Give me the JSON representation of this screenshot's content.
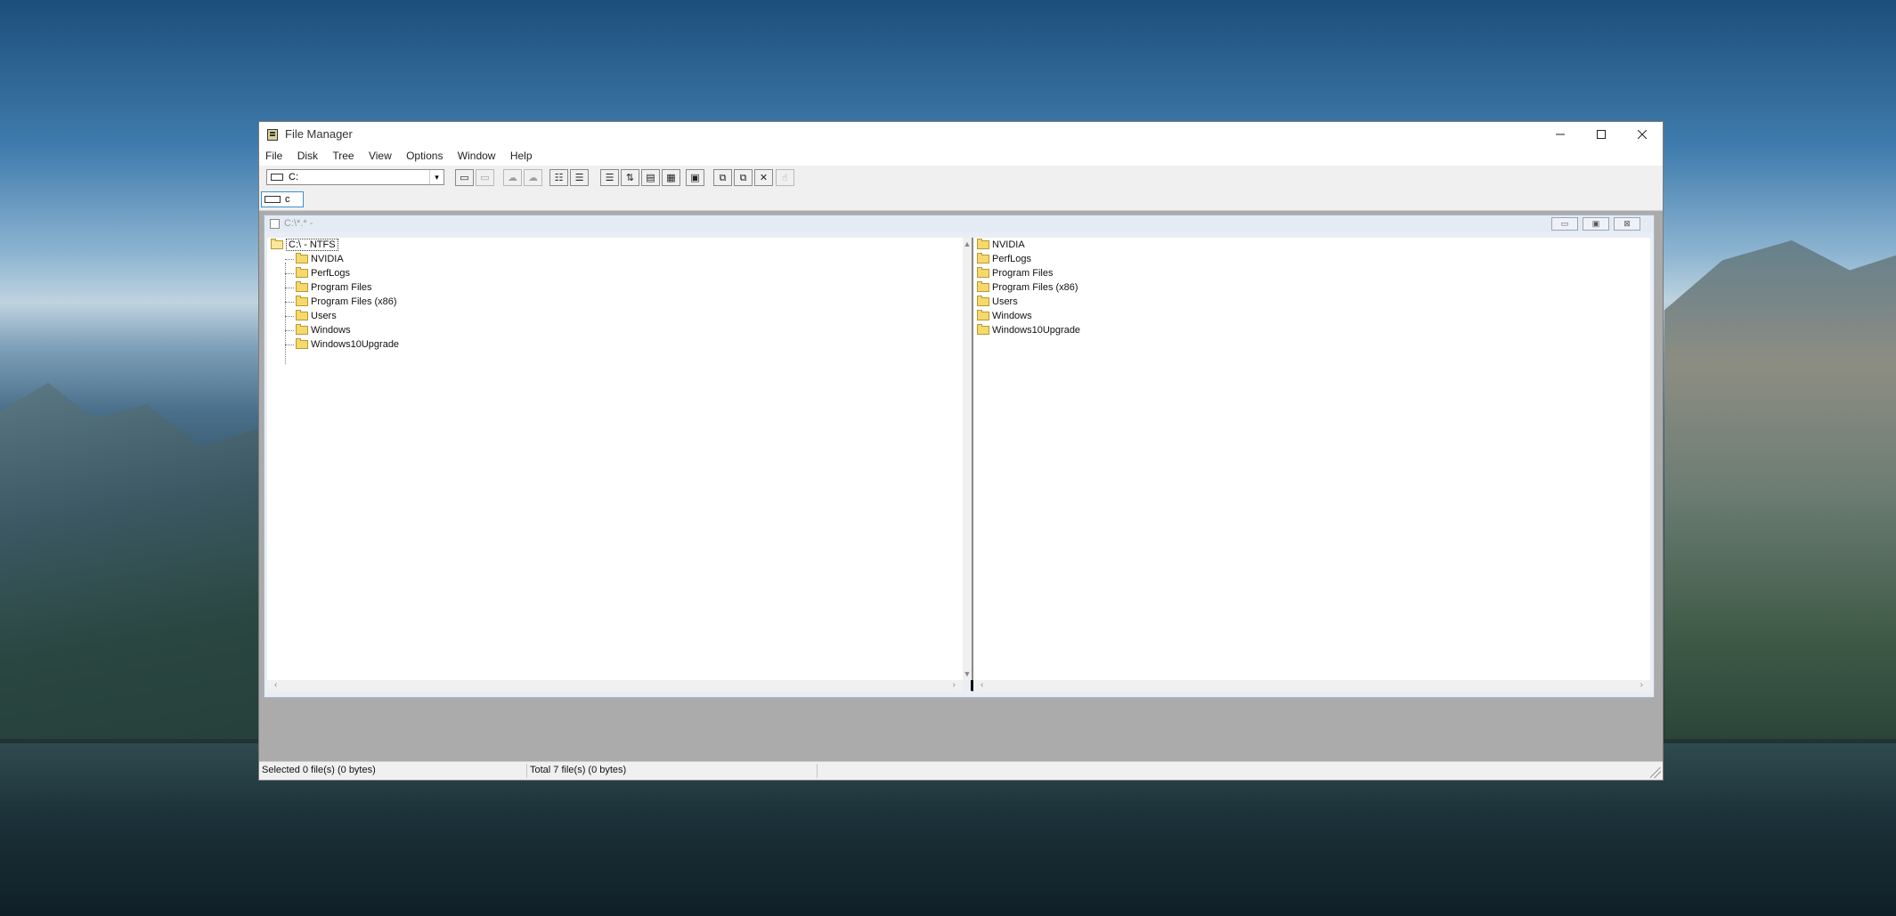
{
  "window": {
    "title": "File Manager"
  },
  "menu": [
    "File",
    "Disk",
    "Tree",
    "View",
    "Options",
    "Window",
    "Help"
  ],
  "toolbar": {
    "drive_selected": "C:",
    "combo_arrow": "▾"
  },
  "drivebar": {
    "drive_tab_label": "c"
  },
  "mdi": {
    "title": "C:\\*.* -"
  },
  "tree": {
    "root": "C:\\ - NTFS",
    "folders": [
      "NVIDIA",
      "PerfLogs",
      "Program Files",
      "Program Files (x86)",
      "Users",
      "Windows",
      "Windows10Upgrade"
    ]
  },
  "files": [
    "NVIDIA",
    "PerfLogs",
    "Program Files",
    "Program Files (x86)",
    "Users",
    "Windows",
    "Windows10Upgrade"
  ],
  "status": {
    "selected": "Selected 0 file(s) (0 bytes)",
    "total": "Total 7 file(s) (0 bytes)"
  }
}
